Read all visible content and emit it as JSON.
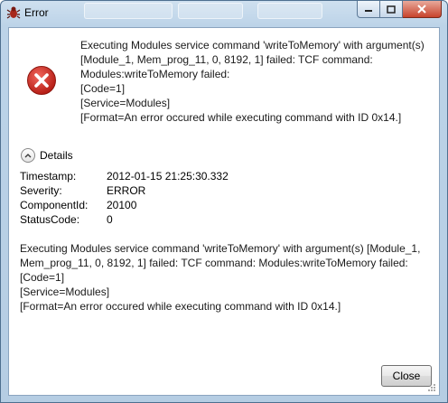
{
  "window": {
    "title": "Error"
  },
  "message": {
    "text": "Executing Modules service command 'writeToMemory' with argument(s)\n[Module_1, Mem_prog_11, 0, 8192, 1] failed: TCF command:\nModules:writeToMemory failed:\n[Code=1]\n[Service=Modules]\n[Format=An error occured while executing command with ID 0x14.]"
  },
  "details": {
    "toggle_label": "Details",
    "fields": [
      {
        "key": "Timestamp:",
        "value": "2012-01-15 21:25:30.332"
      },
      {
        "key": "Severity:",
        "value": "ERROR"
      },
      {
        "key": "ComponentId:",
        "value": "20100"
      },
      {
        "key": "StatusCode:",
        "value": "0"
      }
    ],
    "message": "Executing Modules service command 'writeToMemory' with argument(s) [Module_1,\nMem_prog_11, 0, 8192, 1] failed: TCF command: Modules:writeToMemory failed:\n[Code=1]\n[Service=Modules]\n[Format=An error occured while executing command with ID 0x14.]"
  },
  "buttons": {
    "close_label": "Close"
  },
  "icons": {
    "app": "bug-icon",
    "error": "error-icon"
  },
  "colors": {
    "error_red": "#d62b22",
    "window_frame": "#bcd3e8"
  }
}
